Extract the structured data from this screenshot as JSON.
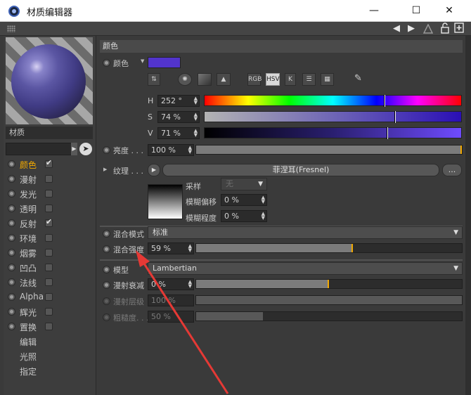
{
  "window": {
    "title": "材质编辑器",
    "minimize_glyph": "—",
    "maximize_glyph": "☐",
    "close_glyph": "✕"
  },
  "toolstrip": {
    "nav_back_glyph": "◀",
    "nav_forward_glyph": "▶",
    "icons": [
      "grip-icon",
      "nav-back-icon",
      "nav-forward-icon",
      "up-icon",
      "lock-icon",
      "new-panel-icon"
    ]
  },
  "left_panel": {
    "material_name": "材质",
    "channels": [
      {
        "label": "颜色",
        "checked": true,
        "active": true
      },
      {
        "label": "漫射",
        "checked": false
      },
      {
        "label": "发光",
        "checked": false
      },
      {
        "label": "透明",
        "checked": false
      },
      {
        "label": "反射",
        "checked": true
      },
      {
        "label": "环境",
        "checked": false
      },
      {
        "label": "烟雾",
        "checked": false
      },
      {
        "label": "凹凸",
        "checked": false
      },
      {
        "label": "法线",
        "checked": false
      },
      {
        "label": "Alpha",
        "checked": false
      },
      {
        "label": "辉光",
        "checked": false
      },
      {
        "label": "置换",
        "checked": false
      }
    ],
    "extras": [
      "编辑",
      "光照",
      "指定"
    ]
  },
  "color_section": {
    "title": "颜色",
    "color_label": "颜色",
    "swatch_color": "#5234cc",
    "mode_buttons": [
      "RGB",
      "HSV",
      "K"
    ],
    "selected_mode": "HSV",
    "h": {
      "label": "H",
      "value": "252 °",
      "level": 0.7
    },
    "s": {
      "label": "S",
      "value": "74 %",
      "level": 0.74
    },
    "v": {
      "label": "V",
      "value": "71 %",
      "level": 0.71
    },
    "brightness": {
      "label": "亮度 . . .",
      "value": "100 %",
      "level": 1.0
    },
    "texture": {
      "label": "纹理 . . .",
      "shader_name": "菲涅耳(Fresnel)",
      "more": "..."
    },
    "sampling": {
      "label": "采样",
      "value": "无"
    },
    "blur_offset": {
      "label": "模糊偏移",
      "value": "0 %"
    },
    "blur_scale": {
      "label": "模糊程度",
      "value": "0 %"
    },
    "mix_mode": {
      "label": "混合模式",
      "value": "标准"
    },
    "mix_strength": {
      "label": "混合强度",
      "value": "59 %",
      "level": 0.59
    }
  },
  "model_section": {
    "model": {
      "label": "模型",
      "value": "Lambertian"
    },
    "diffuse_falloff": {
      "label": "漫射衰减",
      "value": "0 %",
      "level": 0.5
    },
    "diffuse_level": {
      "label": "漫射层级",
      "value": "100 %",
      "level": 1.0
    },
    "roughness": {
      "label": "粗糙度. . .",
      "value": "50 %",
      "level": 0.25
    }
  }
}
